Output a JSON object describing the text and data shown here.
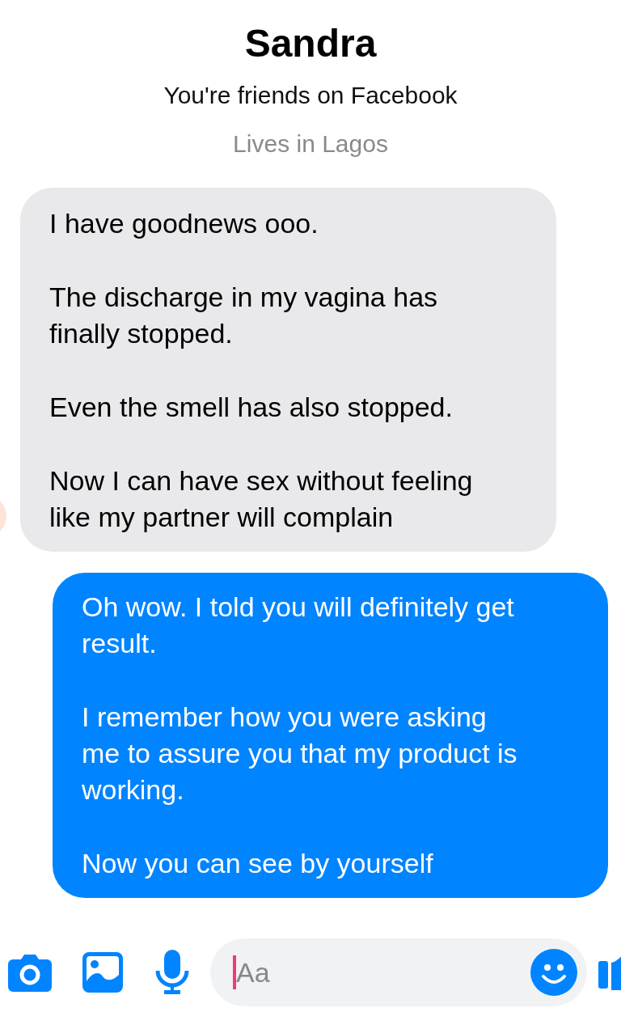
{
  "header": {
    "name": "Sandra",
    "friendship": "You're friends on Facebook",
    "location": "Lives in Lagos"
  },
  "messages": [
    {
      "kind": "received",
      "paragraphs": [
        "I have goodnews ooo.",
        "The discharge in my vagina has finally stopped.",
        "Even the smell has also stopped.",
        "Now I can have sex without feeling like my partner will complain"
      ]
    },
    {
      "kind": "sent",
      "paragraphs": [
        "Oh wow. I told you will definitely get result.",
        "I remember how you were asking me to assure you that my product is working.",
        "Now you can see by yourself"
      ]
    }
  ],
  "composer": {
    "placeholder": "Aa"
  }
}
